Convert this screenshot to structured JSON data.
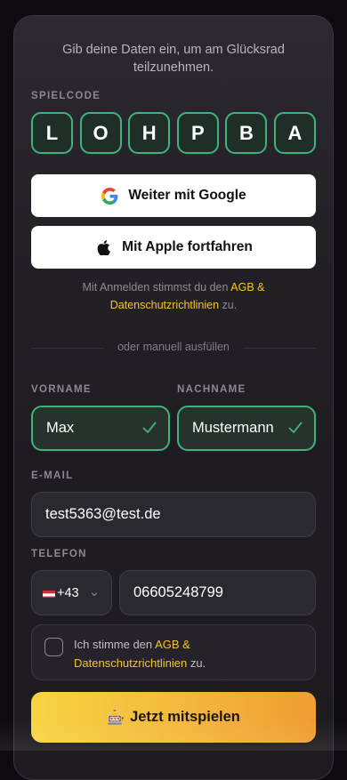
{
  "intro": {
    "line1": "Gib deine Daten ein, um am Glücksrad",
    "line2": "teilzunehmen."
  },
  "game_code": {
    "label": "SPIELCODE",
    "letters": [
      "L",
      "O",
      "H",
      "P",
      "B",
      "A"
    ]
  },
  "social": {
    "google_label": "Weiter mit Google",
    "apple_label": "Mit Apple fortfahren"
  },
  "legal": {
    "prefix": "Mit Anmelden stimmst du den",
    "link": "AGB & Datenschutzrichtlinien",
    "suffix": "zu."
  },
  "divider": {
    "text": "oder manuell ausfüllen"
  },
  "form": {
    "first_name": {
      "label": "VORNAME",
      "value": "Max"
    },
    "last_name": {
      "label": "NACHNAME",
      "value": "Mustermann"
    },
    "email": {
      "label": "E-MAIL",
      "value": "test5363@test.de"
    },
    "phone": {
      "label": "TELEFON",
      "country_code": "+43",
      "value": "06605248799"
    }
  },
  "consent": {
    "prefix": "Ich stimme den",
    "link": "AGB & Datenschutzrichtlinien",
    "suffix": "zu."
  },
  "cta": {
    "emoji": "🎰",
    "label": "Jetzt mitspielen"
  },
  "colors": {
    "accent_green": "#3fb37f",
    "link_yellow": "#f5c431",
    "cta_gradient_start": "#f7d443",
    "cta_gradient_end": "#ef9d33"
  },
  "icons": {
    "google": "google-icon",
    "apple": "apple-icon",
    "check": "check-icon",
    "flag": "austria-flag-icon",
    "chevron": "chevron-down-icon"
  }
}
